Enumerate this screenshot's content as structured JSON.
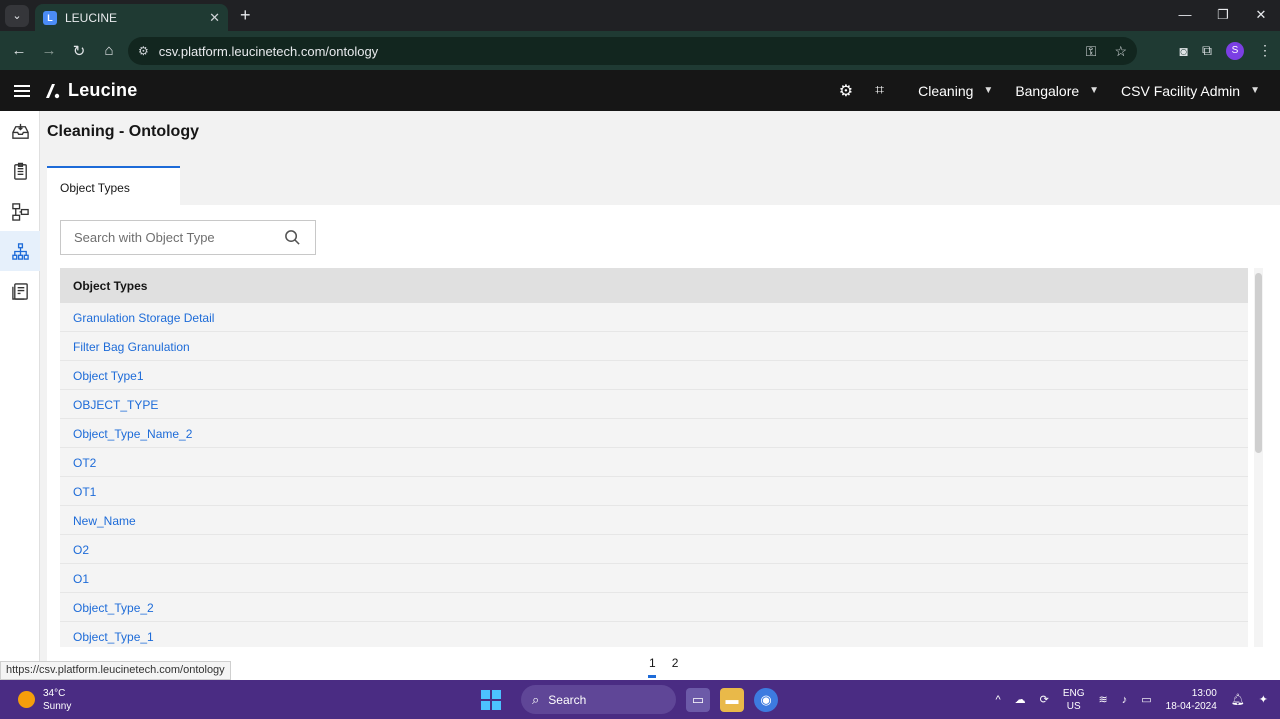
{
  "browser": {
    "tab_title": "LEUCINE",
    "url": "csv.platform.leucinetech.com/ontology",
    "status_url": "https://csv.platform.leucinetech.com/ontology",
    "profile_initial": "S"
  },
  "header": {
    "logo_text": "Leucine",
    "use_case": "Cleaning",
    "facility": "Bangalore",
    "user": "CSV Facility Admin"
  },
  "sidebar": {
    "items": [
      {
        "icon": "inbox-icon"
      },
      {
        "icon": "checklist-icon"
      },
      {
        "icon": "process-icon"
      },
      {
        "icon": "ontology-icon",
        "active": true
      },
      {
        "icon": "reports-icon"
      }
    ]
  },
  "page": {
    "title": "Cleaning - Ontology",
    "tab": "Object Types",
    "search_placeholder": "Search with Object Type"
  },
  "table": {
    "header": "Object Types",
    "rows": [
      "Granulation Storage Detail",
      "Filter Bag Granulation",
      "Object Type1",
      "OBJECT_TYPE",
      "Object_Type_Name_2",
      "OT2",
      "OT1",
      "New_Name",
      "O2",
      "O1",
      "Object_Type_2",
      "Object_Type_1"
    ]
  },
  "pagination": {
    "pages": [
      "1",
      "2"
    ],
    "current": "1"
  },
  "taskbar": {
    "temperature": "34°C",
    "weather": "Sunny",
    "search": "Search",
    "lang_1": "ENG",
    "lang_2": "US",
    "time": "13:00",
    "date": "18-04-2024"
  },
  "colors": {
    "accent": "#1d6bd8",
    "header_bg": "#161616",
    "taskbar_bg": "#4a2c83"
  }
}
